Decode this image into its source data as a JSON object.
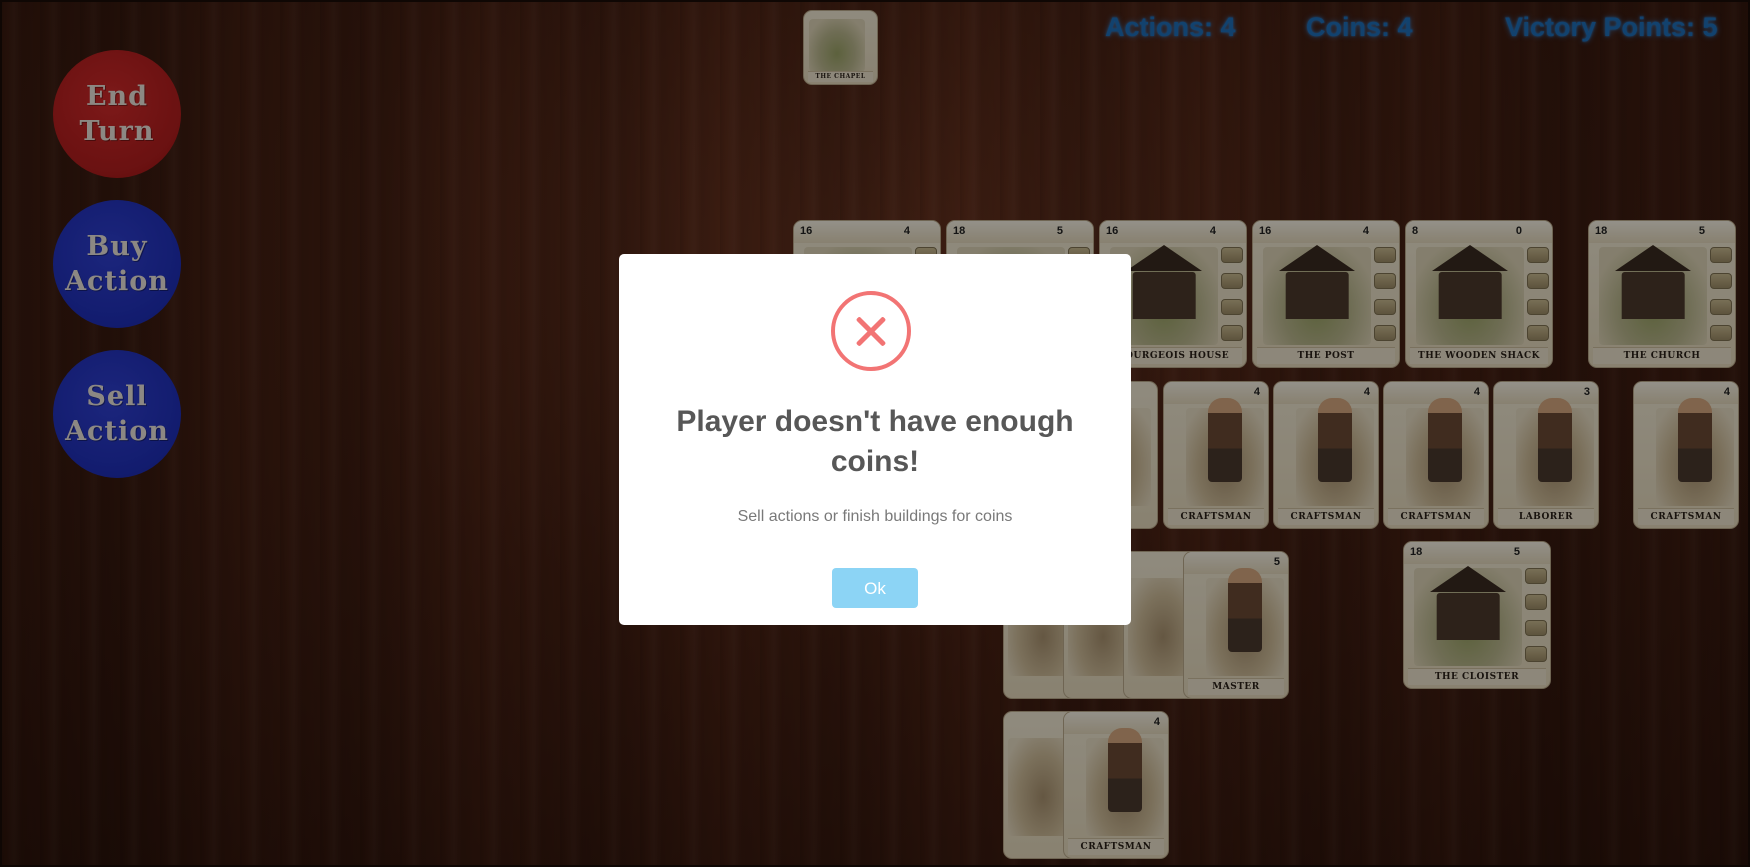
{
  "header": {
    "actions": "Actions: 4",
    "coins": "Coins: 4",
    "victory_points": "Victory Points: 5"
  },
  "buttons": {
    "end_turn": [
      "End",
      "Turn"
    ],
    "buy_action": [
      "Buy",
      "Action"
    ],
    "sell_action": [
      "Sell",
      "Action"
    ]
  },
  "card_small": {
    "name": "The Chapel"
  },
  "buildings": [
    {
      "cost": "16",
      "victory": "4",
      "name": ""
    },
    {
      "cost": "18",
      "victory": "5",
      "name": ""
    },
    {
      "cost": "16",
      "victory": "4",
      "name": "Bourgeois House"
    },
    {
      "cost": "16",
      "victory": "4",
      "name": "The Post"
    },
    {
      "cost": "8",
      "victory": "0",
      "name": "The Wooden Shack"
    },
    {
      "cost": "18",
      "victory": "5",
      "name": "The Church"
    }
  ],
  "workers_row": [
    {
      "cost": "4",
      "name": "Craftsman"
    },
    {
      "cost": "4",
      "name": "Craftsman"
    },
    {
      "cost": "4",
      "name": "Craftsman"
    },
    {
      "cost": "3",
      "name": "Laborer"
    },
    {
      "cost": "4",
      "name": "Craftsman"
    }
  ],
  "master_card": {
    "cost": "5",
    "name": "Master"
  },
  "cloister": {
    "cost": "18",
    "victory": "5",
    "name": "The Cloister"
  },
  "bottom_card": {
    "cost": "4",
    "name": "Craftsman"
  },
  "dialog": {
    "title": "Player doesn't have enough coins!",
    "text": "Sell actions or finish buildings for coins",
    "ok_label": "Ok",
    "icon": "error-x-icon",
    "icon_color": "#f27474",
    "button_color": "#8cd4f5"
  }
}
